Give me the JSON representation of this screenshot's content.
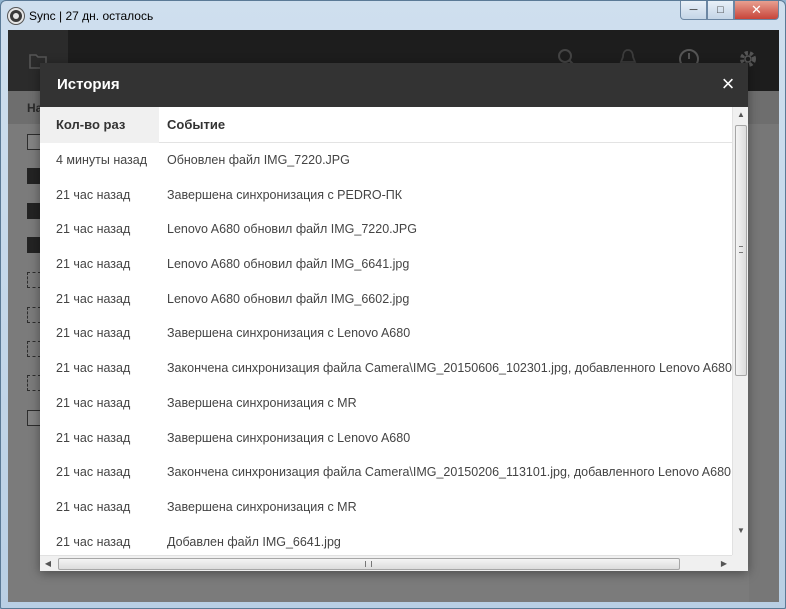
{
  "window": {
    "title": "Sync | 27 дн. осталось",
    "minimize": "─",
    "maximize": "□",
    "close": "✕"
  },
  "app": {
    "subhead_fragment": "На"
  },
  "dialog": {
    "title": "История",
    "close_glyph": "×",
    "columns": [
      "Кол-во раз",
      "Событие"
    ],
    "rows": [
      {
        "time": "4 минуты назад",
        "event": "Обновлен файл IMG_7220.JPG"
      },
      {
        "time": "21 час назад",
        "event": "Завершена синхронизация с PEDRO-ПК"
      },
      {
        "time": "21 час назад",
        "event": "Lenovo A680 обновил файл IMG_7220.JPG"
      },
      {
        "time": "21 час назад",
        "event": "Lenovo A680 обновил файл IMG_6641.jpg"
      },
      {
        "time": "21 час назад",
        "event": "Lenovo A680 обновил файл IMG_6602.jpg"
      },
      {
        "time": "21 час назад",
        "event": "Завершена синхронизация с Lenovo A680"
      },
      {
        "time": "21 час назад",
        "event": "Закончена синхронизация файла Camera\\IMG_20150606_102301.jpg, добавленного Lenovo A680"
      },
      {
        "time": "21 час назад",
        "event": "Завершена синхронизация с MR"
      },
      {
        "time": "21 час назад",
        "event": "Завершена синхронизация с Lenovo A680"
      },
      {
        "time": "21 час назад",
        "event": "Закончена синхронизация файла Camera\\IMG_20150206_113101.jpg, добавленного Lenovo A680"
      },
      {
        "time": "21 час назад",
        "event": "Завершена синхронизация с MR"
      },
      {
        "time": "21 час назад",
        "event": "Добавлен файл IMG_6641.jpg"
      }
    ]
  },
  "colors": {
    "dialog_header": "#333333",
    "app_toolbar": "#1d1d1d",
    "overlay": "#7b7b7b"
  }
}
